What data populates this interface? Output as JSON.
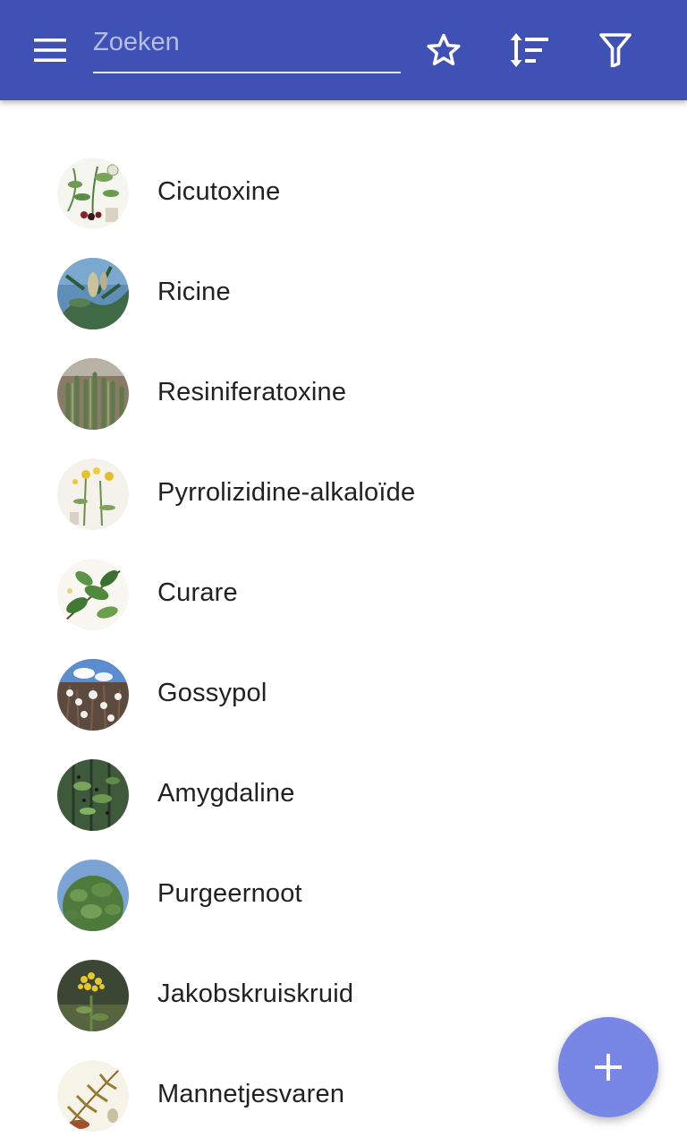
{
  "appbar": {
    "background_color": "#3f51b5",
    "menu_icon": "hamburger-menu-icon",
    "search": {
      "placeholder": "Zoeken",
      "value": ""
    },
    "actions": [
      "star-outline-icon",
      "sort-icon",
      "filter-icon"
    ]
  },
  "list": {
    "items": [
      {
        "label": "Cicutoxine",
        "image": "botanical-illustration"
      },
      {
        "label": "Ricine",
        "image": "plant-photo-sky"
      },
      {
        "label": "Resiniferatoxine",
        "image": "plant-photo-succulent"
      },
      {
        "label": "Pyrrolizidine-alkaloïde",
        "image": "botanical-illustration-yellow-flowers"
      },
      {
        "label": "Curare",
        "image": "botanical-illustration-leaves"
      },
      {
        "label": "Gossypol",
        "image": "plant-photo-cotton"
      },
      {
        "label": "Amygdaline",
        "image": "plant-photo-green"
      },
      {
        "label": "Purgeernoot",
        "image": "plant-photo-shrub"
      },
      {
        "label": "Jakobskruiskruid",
        "image": "plant-photo-yellow-flowers"
      },
      {
        "label": "Mannetjesvaren",
        "image": "botanical-illustration-fern"
      }
    ]
  },
  "fab": {
    "icon": "plus-icon",
    "color": "#7886e6"
  }
}
